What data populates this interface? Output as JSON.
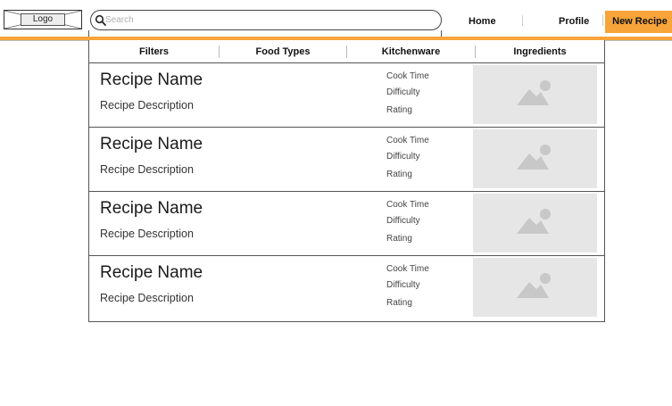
{
  "header": {
    "logo_label": "Logo",
    "search_placeholder": "Search",
    "nav": {
      "home": "Home",
      "profile": "Profile",
      "new_recipe": "New Recipe"
    }
  },
  "colors": {
    "accent": "#f7a43a",
    "image_placeholder": "#e6e6e6",
    "image_icon": "#c8c8c8"
  },
  "filters": [
    "Filters",
    "Food Types",
    "Kitchenware",
    "Ingredients"
  ],
  "recipes": [
    {
      "name": "Recipe Name",
      "description": "Recipe Description",
      "cook_time": "Cook Time",
      "difficulty": "Difficulty",
      "rating": "Rating",
      "image_icon": "image-placeholder-icon"
    },
    {
      "name": "Recipe Name",
      "description": "Recipe Description",
      "cook_time": "Cook Time",
      "difficulty": "Difficulty",
      "rating": "Rating",
      "image_icon": "image-placeholder-icon"
    },
    {
      "name": "Recipe Name",
      "description": "Recipe Description",
      "cook_time": "Cook Time",
      "difficulty": "Difficulty",
      "rating": "Rating",
      "image_icon": "image-placeholder-icon"
    },
    {
      "name": "Recipe Name",
      "description": "Recipe Description",
      "cook_time": "Cook Time",
      "difficulty": "Difficulty",
      "rating": "Rating",
      "image_icon": "image-placeholder-icon"
    }
  ]
}
